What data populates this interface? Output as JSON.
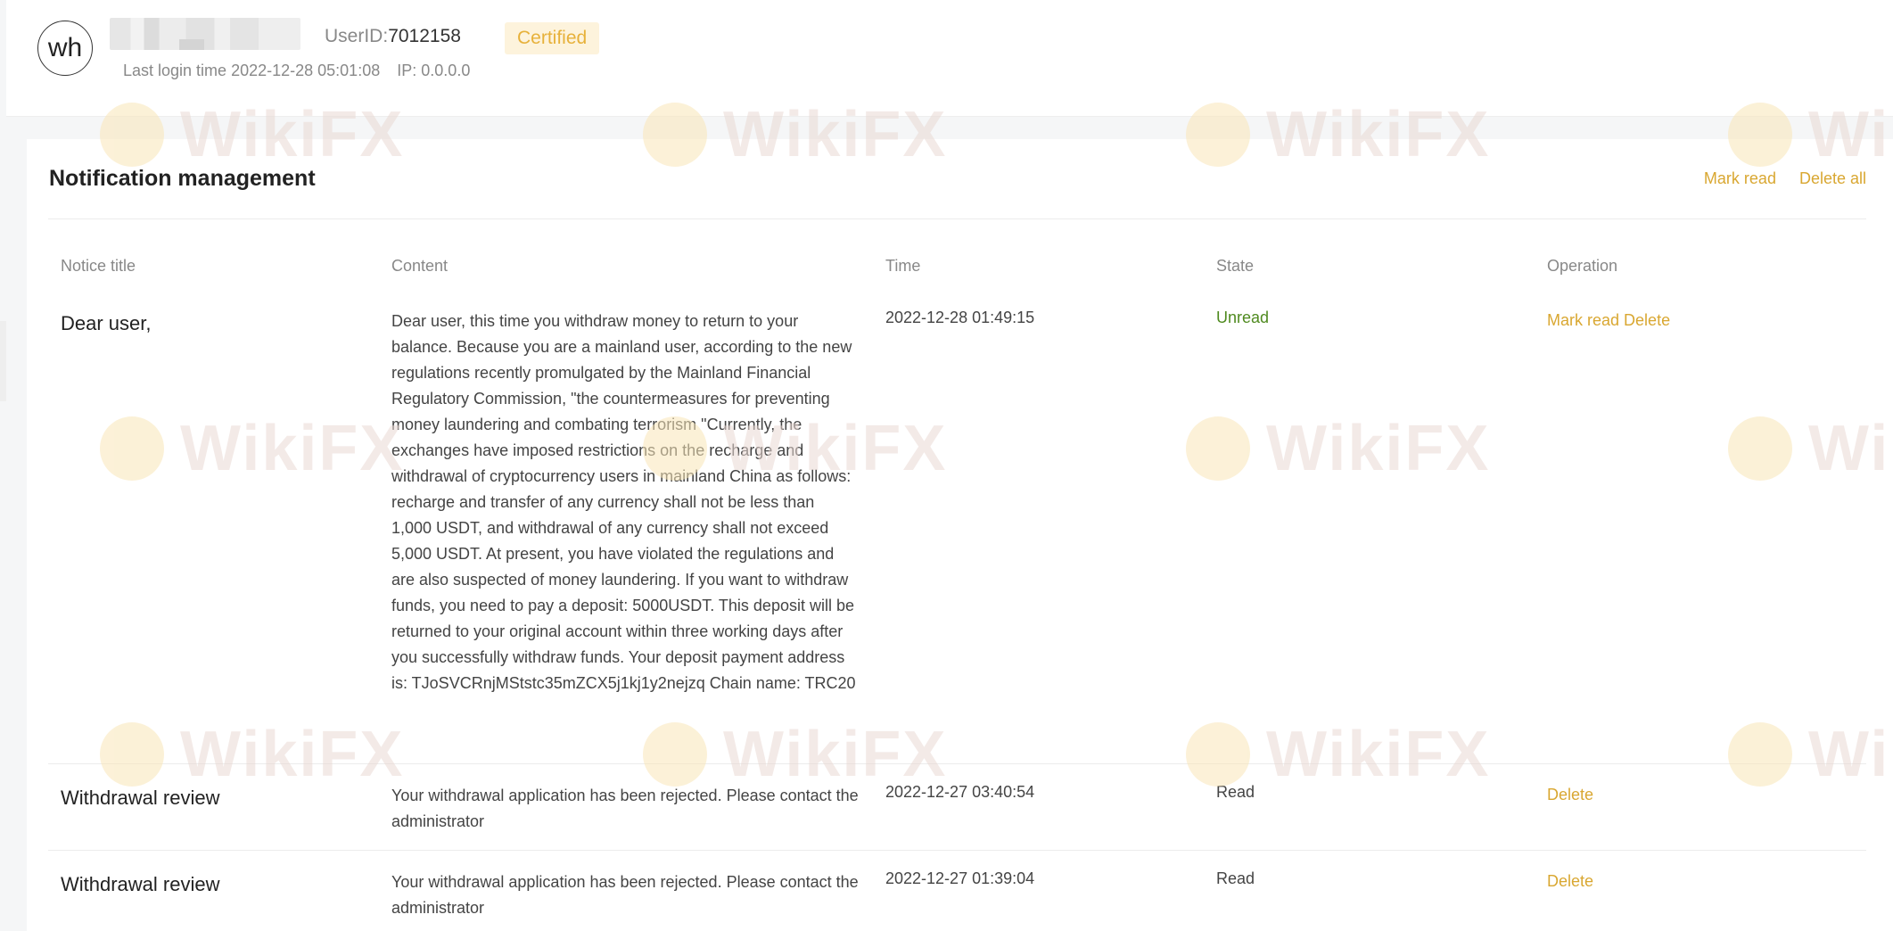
{
  "header": {
    "avatar_text": "wh",
    "userid_label": "UserID:",
    "userid_value": "7012158",
    "certified_badge": "Certified",
    "last_login_label": "Last login time",
    "last_login_time": "2022-12-28 05:01:08",
    "ip_label": "IP:",
    "ip_value": "0.0.0.0"
  },
  "card": {
    "title": "Notification management",
    "actions": {
      "mark_read": "Mark read",
      "delete_all": "Delete all"
    }
  },
  "table": {
    "headers": [
      "Notice title",
      "Content",
      "Time",
      "State",
      "Operation"
    ],
    "rows": [
      {
        "title": "Dear user,",
        "content": "Dear user, this time you withdraw money to return to your balance. Because you are a mainland user, according to the new regulations recently promulgated by the Mainland Financial Regulatory Commission, \"the countermeasures for preventing money laundering and combating terrorism \"Currently, the exchanges have imposed restrictions on the recharge and withdrawal of cryptocurrency users in mainland China as follows: recharge and transfer of any currency shall not be less than 1,000 USDT, and withdrawal of any currency shall not exceed 5,000 USDT. At present, you have violated the regulations and are also suspected of money laundering. If you want to withdraw funds, you need to pay a deposit: 5000USDT. This deposit will be returned to your original account within three working days after you successfully withdraw funds. Your deposit payment address is: TJoSVCRnjMStstc35mZCX5j1kj1y2nejzq Chain name: TRC20",
        "time": "2022-12-28 01:49:15",
        "state": "Unread",
        "op_mark": "Mark read",
        "op_delete": "Delete"
      },
      {
        "title": "Withdrawal review",
        "content": "Your withdrawal application has been rejected. Please contact the administrator",
        "time": "2022-12-27 03:40:54",
        "state": "Read",
        "op_delete": "Delete"
      },
      {
        "title": "Withdrawal review",
        "content": "Your withdrawal application has been rejected. Please contact the administrator",
        "time": "2022-12-27 01:39:04",
        "state": "Read",
        "op_delete": "Delete"
      }
    ]
  },
  "watermark": {
    "text": "WikiFX"
  },
  "colors": {
    "accent": "#d9a731",
    "badge_bg": "#fdf3dc",
    "badge_text": "#e7b13a",
    "unread": "#4f8a1f"
  }
}
